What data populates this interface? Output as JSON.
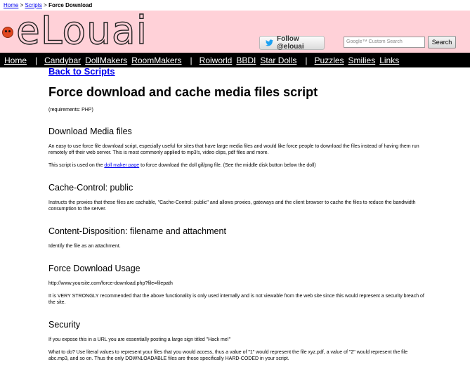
{
  "breadcrumb": {
    "home": "Home",
    "sep1": ">",
    "scripts": "Scripts",
    "sep2": ">",
    "current": "Force Download"
  },
  "header": {
    "logo_text": "eLouai",
    "follow_label": "Follow @elouai",
    "search_placeholder": "Google™ Custom Search",
    "search_button": "Search",
    "bg_color": "#ffd1d8"
  },
  "nav": {
    "items": [
      "Home",
      "|",
      "Candybar",
      "DollMakers",
      "RoomMakers",
      "|",
      "Roiworld",
      "BBDI",
      "Star Dolls",
      "|",
      "Puzzles",
      "Smilies",
      "Links"
    ]
  },
  "content": {
    "back_link": "Back to Scripts",
    "title": "Force download and cache media files script",
    "requirements": "(requirements: PHP)",
    "sections": [
      {
        "heading": "Download Media files",
        "p1": "An easy to use force file download script, especially useful for sites that have large media files and would like force people to download the files instead of having them run remotely off their web server. This is most commonly applied to mp3's, video clips, pdf files and more.",
        "p2_before": "This script is used on the ",
        "p2_link": "doll maker page",
        "p2_after": " to force download the doll gif/png file. (See the middle disk button below the doll)"
      },
      {
        "heading": "Cache-Control: public",
        "p1": "Instructs the proxies that these files are cachable, \"Cache-Control: public\" and allows proxies, gateways and the client browser to cache the files to reduce the bandwidth consumption to the server."
      },
      {
        "heading": "Content-Disposition: filename and attachment",
        "p1": "Identify the file as an attachment."
      },
      {
        "heading": "Force Download Usage",
        "p1": "http://www.yoursite.com/force-download.php?file=filepath",
        "p2": "It is VERY STRONGLY recommended that the above functionality is only used internally and is not viewable from the web site since this would represent a security breach of the site."
      },
      {
        "heading": "Security",
        "p1": "If you expose this in a URL you are essentially posting a large sign titled \"Hack me!\"",
        "p2": "What to do? Use literal values to represent your files that you would access, thus a value of \"1\" would represent the file xyz.pdf, a value of \"2\" would represent the file abc.mp3, and so on. Thus the only DOWNLOADABLE files are those specifically HARD-CODED in your script."
      }
    ]
  }
}
